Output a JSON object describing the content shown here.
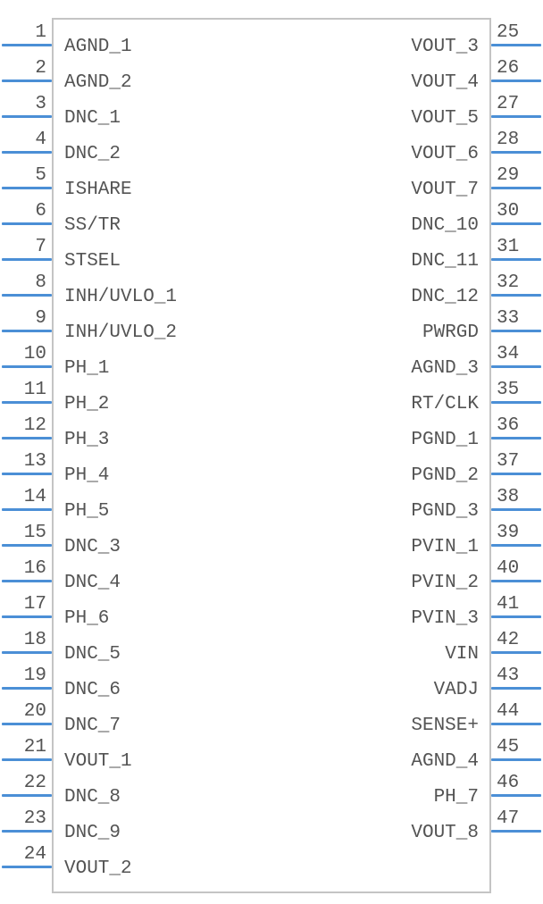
{
  "component": {
    "left_pins": [
      {
        "num": "1",
        "name": "AGND_1"
      },
      {
        "num": "2",
        "name": "AGND_2"
      },
      {
        "num": "3",
        "name": "DNC_1"
      },
      {
        "num": "4",
        "name": "DNC_2"
      },
      {
        "num": "5",
        "name": "ISHARE"
      },
      {
        "num": "6",
        "name": "SS/TR"
      },
      {
        "num": "7",
        "name": "STSEL"
      },
      {
        "num": "8",
        "name": "INH/UVLO_1"
      },
      {
        "num": "9",
        "name": "INH/UVLO_2"
      },
      {
        "num": "10",
        "name": "PH_1"
      },
      {
        "num": "11",
        "name": "PH_2"
      },
      {
        "num": "12",
        "name": "PH_3"
      },
      {
        "num": "13",
        "name": "PH_4"
      },
      {
        "num": "14",
        "name": "PH_5"
      },
      {
        "num": "15",
        "name": "DNC_3"
      },
      {
        "num": "16",
        "name": "DNC_4"
      },
      {
        "num": "17",
        "name": "PH_6"
      },
      {
        "num": "18",
        "name": "DNC_5"
      },
      {
        "num": "19",
        "name": "DNC_6"
      },
      {
        "num": "20",
        "name": "DNC_7"
      },
      {
        "num": "21",
        "name": "VOUT_1"
      },
      {
        "num": "22",
        "name": "DNC_8"
      },
      {
        "num": "23",
        "name": "DNC_9"
      },
      {
        "num": "24",
        "name": "VOUT_2"
      }
    ],
    "right_pins": [
      {
        "num": "25",
        "name": "VOUT_3"
      },
      {
        "num": "26",
        "name": "VOUT_4"
      },
      {
        "num": "27",
        "name": "VOUT_5"
      },
      {
        "num": "28",
        "name": "VOUT_6"
      },
      {
        "num": "29",
        "name": "VOUT_7"
      },
      {
        "num": "30",
        "name": "DNC_10"
      },
      {
        "num": "31",
        "name": "DNC_11"
      },
      {
        "num": "32",
        "name": "DNC_12"
      },
      {
        "num": "33",
        "name": "PWRGD"
      },
      {
        "num": "34",
        "name": "AGND_3"
      },
      {
        "num": "35",
        "name": "RT/CLK"
      },
      {
        "num": "36",
        "name": "PGND_1"
      },
      {
        "num": "37",
        "name": "PGND_2"
      },
      {
        "num": "38",
        "name": "PGND_3"
      },
      {
        "num": "39",
        "name": "PVIN_1"
      },
      {
        "num": "40",
        "name": "PVIN_2"
      },
      {
        "num": "41",
        "name": "PVIN_3"
      },
      {
        "num": "42",
        "name": "VIN"
      },
      {
        "num": "43",
        "name": "VADJ"
      },
      {
        "num": "44",
        "name": "SENSE+"
      },
      {
        "num": "45",
        "name": "AGND_4"
      },
      {
        "num": "46",
        "name": "PH_7"
      },
      {
        "num": "47",
        "name": "VOUT_8"
      }
    ]
  }
}
